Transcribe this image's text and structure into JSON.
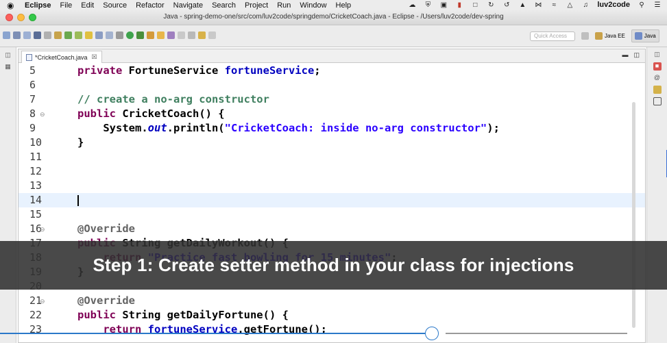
{
  "menubar": {
    "app_name": "Eclipse",
    "items": [
      "File",
      "Edit",
      "Source",
      "Refactor",
      "Navigate",
      "Search",
      "Project",
      "Run",
      "Window",
      "Help"
    ],
    "user": "luv2code"
  },
  "window": {
    "title": "Java - spring-demo-one/src/com/luv2code/springdemo/CricketCoach.java - Eclipse - /Users/luv2code/dev-spring"
  },
  "toolbar": {
    "quick_access_placeholder": "Quick Access",
    "perspectives": [
      "Java EE",
      "Java"
    ]
  },
  "editor": {
    "tab_label": "*CricketCoach.java",
    "tab_close": "☒",
    "lines": [
      {
        "num": "5",
        "text": "private FortuneService fortuneService;"
      },
      {
        "num": "6",
        "text": ""
      },
      {
        "num": "7",
        "text": "// create a no-arg constructor"
      },
      {
        "num": "8",
        "text": "public CricketCoach() {"
      },
      {
        "num": "9",
        "text": "System.out.println(\"CricketCoach: inside no-arg constructor\");"
      },
      {
        "num": "10",
        "text": "}"
      },
      {
        "num": "11",
        "text": ""
      },
      {
        "num": "12",
        "text": ""
      },
      {
        "num": "13",
        "text": ""
      },
      {
        "num": "14",
        "text": ""
      },
      {
        "num": "15",
        "text": ""
      },
      {
        "num": "16",
        "text": "@Override"
      },
      {
        "num": "17",
        "text": "public String getDailyWorkout() {"
      },
      {
        "num": "18",
        "text": "return \"Practice fast bowling for 15 minutes\";"
      },
      {
        "num": "19",
        "text": "}"
      },
      {
        "num": "20",
        "text": ""
      },
      {
        "num": "21",
        "text": "@Override"
      },
      {
        "num": "22",
        "text": "public String getDailyFortune() {"
      },
      {
        "num": "23",
        "text": "return fortuneService.getFortune();"
      }
    ]
  },
  "caption": {
    "text": "Step 1: Create setter method in your class for injections"
  },
  "player": {
    "progress": 0.65
  },
  "colors": {
    "keyword": "#7f0055",
    "field": "#0000c0",
    "comment": "#3f7f5f",
    "string": "#2a00ff",
    "current_line": "#e8f2fe",
    "scrubber": "#2a78c9"
  }
}
